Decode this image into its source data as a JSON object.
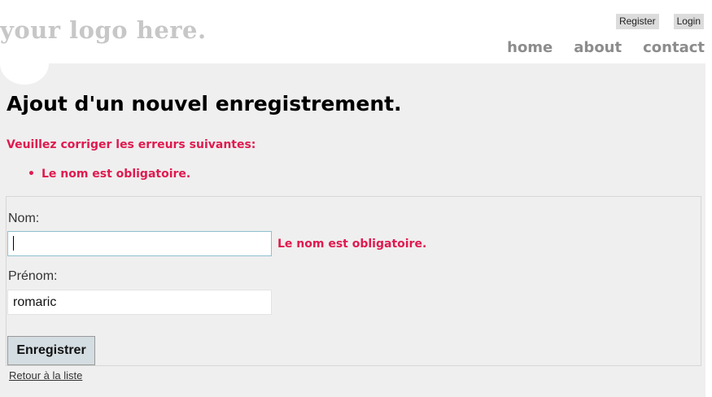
{
  "header": {
    "logo_text": "your logo here.",
    "auth_links": [
      "Register",
      "Login"
    ],
    "nav": [
      "home",
      "about",
      "contact"
    ]
  },
  "main": {
    "title": "Ajout d'un nouvel enregistrement.",
    "error_summary": "Veuillez corriger les erreurs suivantes:",
    "errors": [
      "Le nom est obligatoire."
    ],
    "form": {
      "nom_label": "Nom:",
      "nom_value": "",
      "nom_error": "Le nom est obligatoire.",
      "prenom_label": "Prénom:",
      "prenom_value": "romaric",
      "submit_label": "Enregistrer"
    },
    "back_link": "Retour à la liste"
  },
  "colors": {
    "error": "#e01a4f",
    "background": "#efefef",
    "logo": "#c7c7c7"
  }
}
